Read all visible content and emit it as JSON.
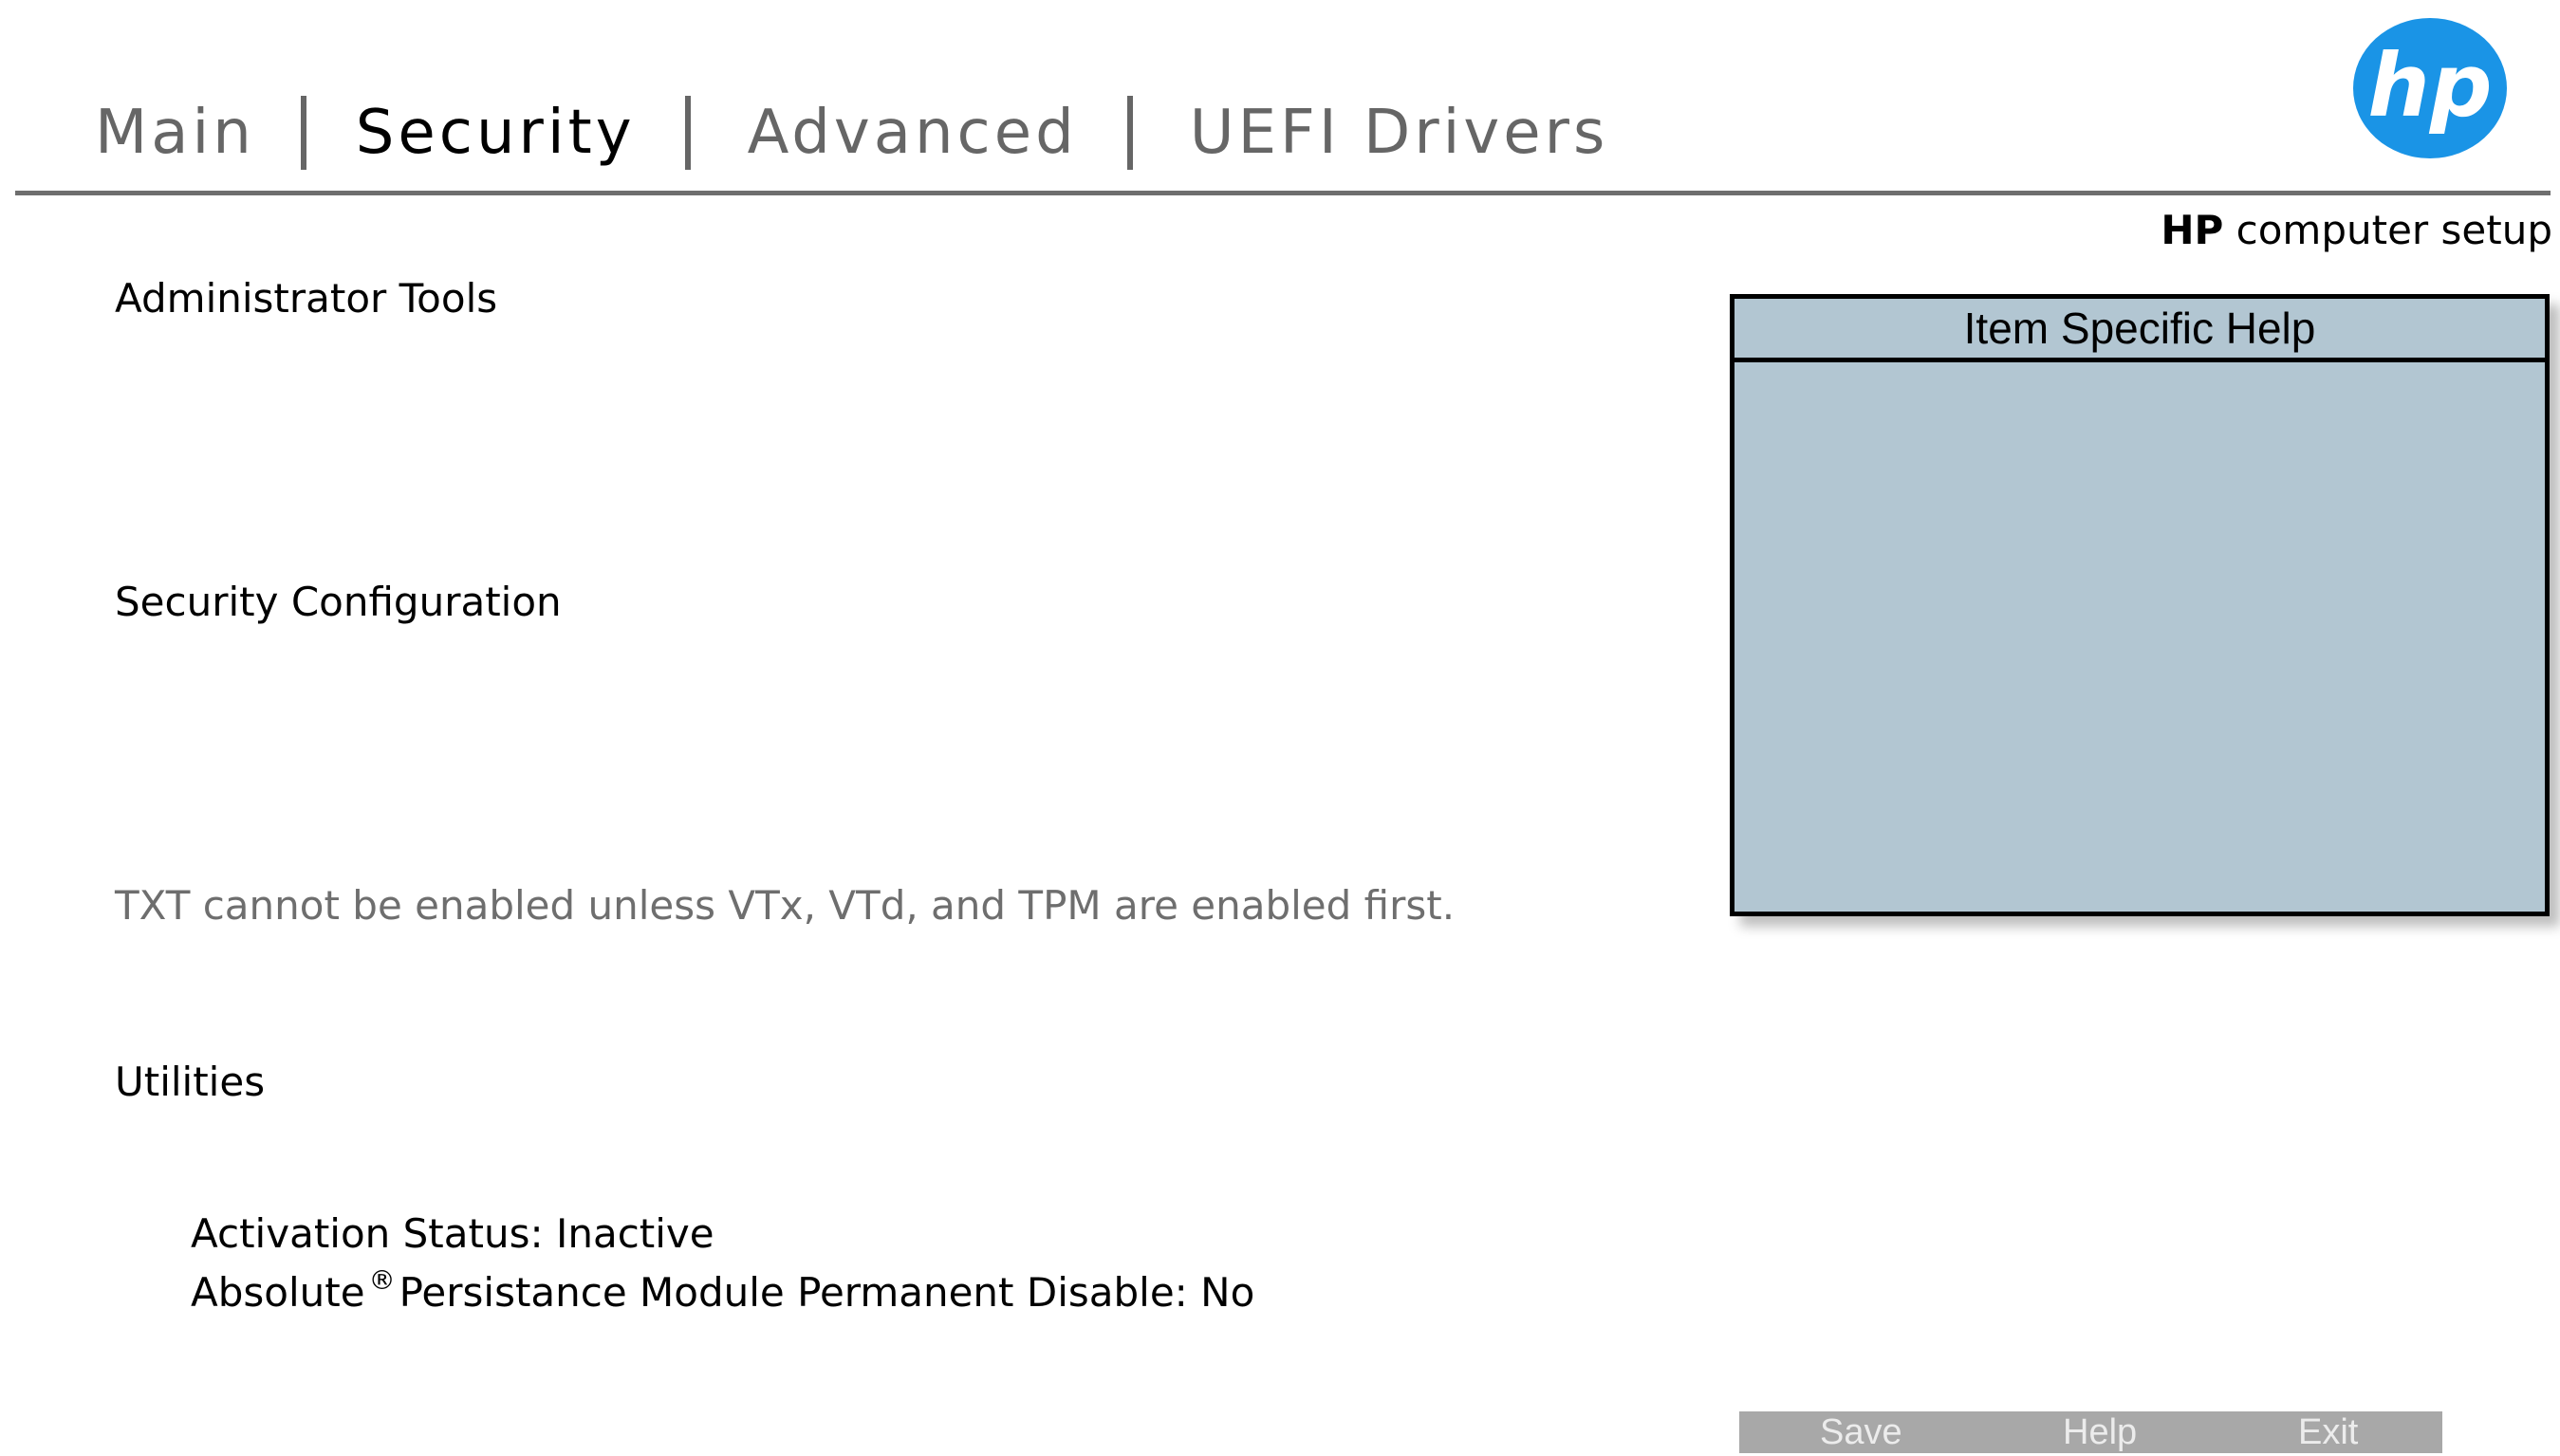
{
  "tabs": [
    {
      "label": "Main",
      "active": false
    },
    {
      "label": "Security",
      "active": true
    },
    {
      "label": "Advanced",
      "active": false
    },
    {
      "label": "UEFI Drivers",
      "active": false
    }
  ],
  "brand": {
    "bold": "HP",
    "rest": " computer setup",
    "logo_text": "hp",
    "logo_color": "#1a94e6"
  },
  "content": {
    "admin_tools": "Administrator Tools",
    "security_config": "Security Configuration",
    "txt_note": "TXT cannot be enabled unless VTx, VTd, and TPM are enabled first.",
    "utilities": "Utilities",
    "activation_status": "Activation Status: Inactive",
    "absolute_prefix": "Absolute",
    "registered_mark": "®",
    "absolute_suffix": "Persistance Module Permanent Disable: No"
  },
  "help_panel": {
    "title": "Item Specific Help",
    "background": "#b2c6d2"
  },
  "buttons": {
    "save": "Save",
    "help": "Help",
    "exit": "Exit"
  }
}
